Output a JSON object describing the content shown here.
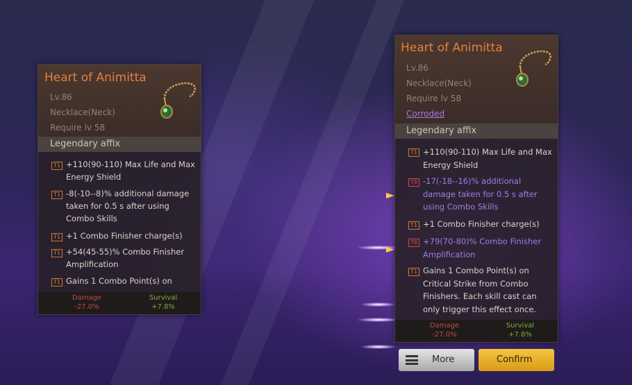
{
  "left_card": {
    "title": "Heart of Animitta",
    "level": "Lv.86",
    "slot": "Necklace(Neck)",
    "requirement": "Require lv 58",
    "section_label": "Legendary affix",
    "affixes": [
      {
        "tier": "T1",
        "text": "+110(90-110) Max Life and Max Energy Shield"
      },
      {
        "tier": "T1",
        "text": "-8(-10--8)% additional damage taken for 0.5 s after using Combo Skills"
      },
      {
        "tier": "T1",
        "text": "+1 Combo Finisher charge(s)"
      },
      {
        "tier": "T1",
        "text": "+54(45-55)% Combo Finisher Amplification"
      },
      {
        "tier": "T1",
        "text": "Gains 1 Combo Point(s) on"
      }
    ],
    "damage_label": "Damage",
    "damage_value": "-27.0%",
    "survival_label": "Survival",
    "survival_value": "+7.8%"
  },
  "right_card": {
    "title": "Heart of Animitta",
    "level": "Lv.86",
    "slot": "Necklace(Neck)",
    "requirement": "Require lv 58",
    "status": "Corroded",
    "section_label": "Legendary affix",
    "affixes": [
      {
        "tier": "T1",
        "text": "+110(90-110) Max Life and Max Energy Shield"
      },
      {
        "tier": "T0",
        "text": "-17(-18--16)% additional damage taken for 0.5 s after using Combo Skills"
      },
      {
        "tier": "T1",
        "text": "+1 Combo Finisher charge(s)"
      },
      {
        "tier": "T0",
        "text": "+79(70-80)% Combo Finisher Amplification"
      },
      {
        "tier": "T1",
        "text": "Gains 1 Combo Point(s) on Critical Strike from Combo Finishers. Each skill cast can only trigger this effect once."
      }
    ],
    "damage_label": "Damage",
    "damage_value": "-27.0%",
    "survival_label": "Survival",
    "survival_value": "+7.8%"
  },
  "buttons": {
    "more_label": "More",
    "confirm_label": "Confirm"
  },
  "icons": {
    "item": "necklace-icon",
    "more": "menu-icon",
    "change_marker": "arrow-right-icon"
  },
  "colors": {
    "title": "#e3803f",
    "upgraded_affix": "#a27ce4",
    "tier_t1": "#d07a2e",
    "tier_t0": "#d34a45",
    "damage_negative": "#c24a3c",
    "survival_positive": "#7fae3c",
    "confirm_button": "#f0b629"
  }
}
